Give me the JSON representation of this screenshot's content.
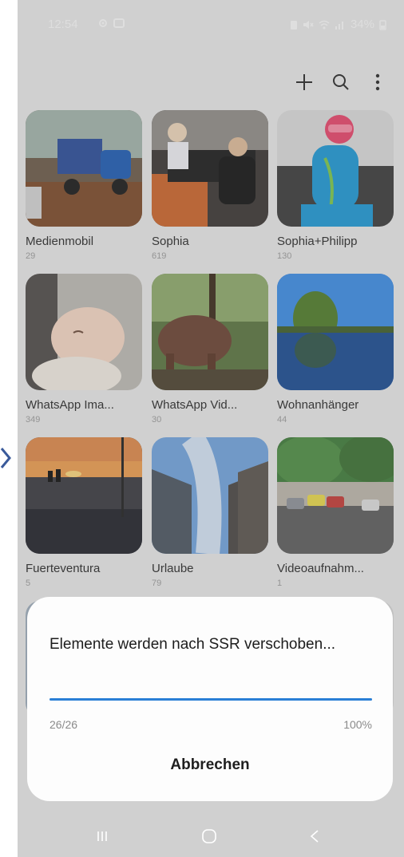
{
  "status_bar": {
    "time": "12:54",
    "battery": "34%"
  },
  "toolbar": {
    "add_icon": "plus-icon",
    "search_icon": "search-icon",
    "more_icon": "more-vertical-icon"
  },
  "albums": [
    {
      "name": "Medienmobil",
      "count": "29"
    },
    {
      "name": "Sophia",
      "count": "619"
    },
    {
      "name": "Sophia+Philipp",
      "count": "130"
    },
    {
      "name": "WhatsApp Ima...",
      "count": "349"
    },
    {
      "name": "WhatsApp Vid...",
      "count": "30"
    },
    {
      "name": "Wohnanhänger",
      "count": "44"
    },
    {
      "name": "Fuerteventura",
      "count": "5"
    },
    {
      "name": "Urlaube",
      "count": "79"
    },
    {
      "name": "Videoaufnahm...",
      "count": "1"
    }
  ],
  "dialog": {
    "title": "Elemente werden nach SSR verschoben...",
    "progress_count": "26/26",
    "progress_percent": "100%",
    "progress_fraction": 1.0,
    "cancel_label": "Abbrechen"
  },
  "colors": {
    "accent": "#2a7fd6",
    "background": "#e3e3e3",
    "dialog": "#fdfdfd"
  }
}
